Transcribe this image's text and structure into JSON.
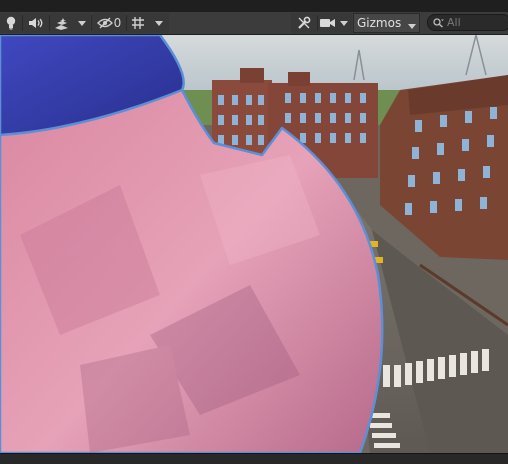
{
  "toolbar": {
    "hidden_count": "0",
    "gizmos_label": "Gizmos",
    "search_placeholder": "All",
    "icons": {
      "lighting": "lightbulb-icon",
      "audio": "speaker-icon",
      "effects": "effects-icon",
      "visibility": "eye-slash-icon",
      "grid": "grid-icon",
      "tools": "wrench-icon",
      "camera": "camera-icon",
      "search": "search-icon"
    }
  },
  "colors": {
    "toolbar_bg": "#3c3c3c",
    "button_bg": "#383838",
    "sky": "#b4c1c9",
    "ground": "#6e6760",
    "brick": "#8a4a3c",
    "character_skin": "#d98aa3",
    "character_hat": "#3a3fb5",
    "selection_outline": "#5b8fd6"
  }
}
